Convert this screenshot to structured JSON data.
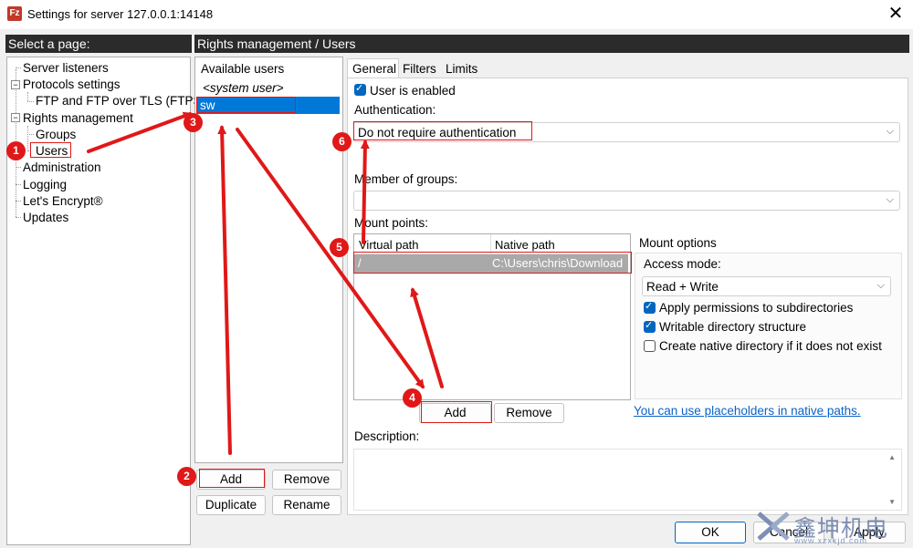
{
  "window": {
    "title": "Settings for server 127.0.0.1:14148",
    "icon": "filezilla-server-icon"
  },
  "left_panel": {
    "header": "Select a page:",
    "items": [
      {
        "label": "Server listeners"
      },
      {
        "label": "Protocols settings"
      },
      {
        "label": "FTP and FTP over TLS (FTPS)"
      },
      {
        "label": "Rights management"
      },
      {
        "label": "Groups"
      },
      {
        "label": "Users"
      },
      {
        "label": "Administration"
      },
      {
        "label": "Logging"
      },
      {
        "label": "Let's Encrypt®"
      },
      {
        "label": "Updates"
      }
    ]
  },
  "right_header": "Rights management / Users",
  "users": {
    "title": "Available users",
    "system_user": "<system user>",
    "selected_user": "sw",
    "buttons": {
      "add": "Add",
      "remove": "Remove",
      "duplicate": "Duplicate",
      "rename": "Rename"
    }
  },
  "tabs": {
    "general": "General",
    "filters": "Filters",
    "limits": "Limits",
    "active": "General"
  },
  "general": {
    "user_enabled_label": "User is enabled",
    "user_enabled": true,
    "authentication_label": "Authentication:",
    "authentication_value": "Do not require authentication",
    "member_groups_label": "Member of groups:",
    "member_groups_value": "",
    "mount_points_label": "Mount points:",
    "mount_table": {
      "columns": [
        "Virtual path",
        "Native path"
      ],
      "rows": [
        {
          "virtual": "/",
          "native": "C:\\Users\\chris\\Download"
        }
      ]
    },
    "mount_add": "Add",
    "mount_remove": "Remove",
    "placeholders_link": "You can use placeholders in native paths.",
    "mount_options": {
      "title": "Mount options",
      "access_mode_label": "Access mode:",
      "access_mode_value": "Read + Write",
      "apply_subdirs": {
        "label": "Apply permissions to subdirectories",
        "checked": true
      },
      "writable_dir": {
        "label": "Writable directory structure",
        "checked": true
      },
      "create_native": {
        "label": "Create native directory if it does not exist",
        "checked": false
      }
    },
    "description_label": "Description:"
  },
  "dialog_buttons": {
    "ok": "OK",
    "cancel": "Cancel",
    "apply": "Apply"
  },
  "annotations": {
    "markers": [
      "1",
      "2",
      "3",
      "4",
      "5",
      "6"
    ],
    "color": "#e01818"
  },
  "watermark": {
    "text": "鑫坤机电",
    "url": "www.xzxkjd.com"
  }
}
